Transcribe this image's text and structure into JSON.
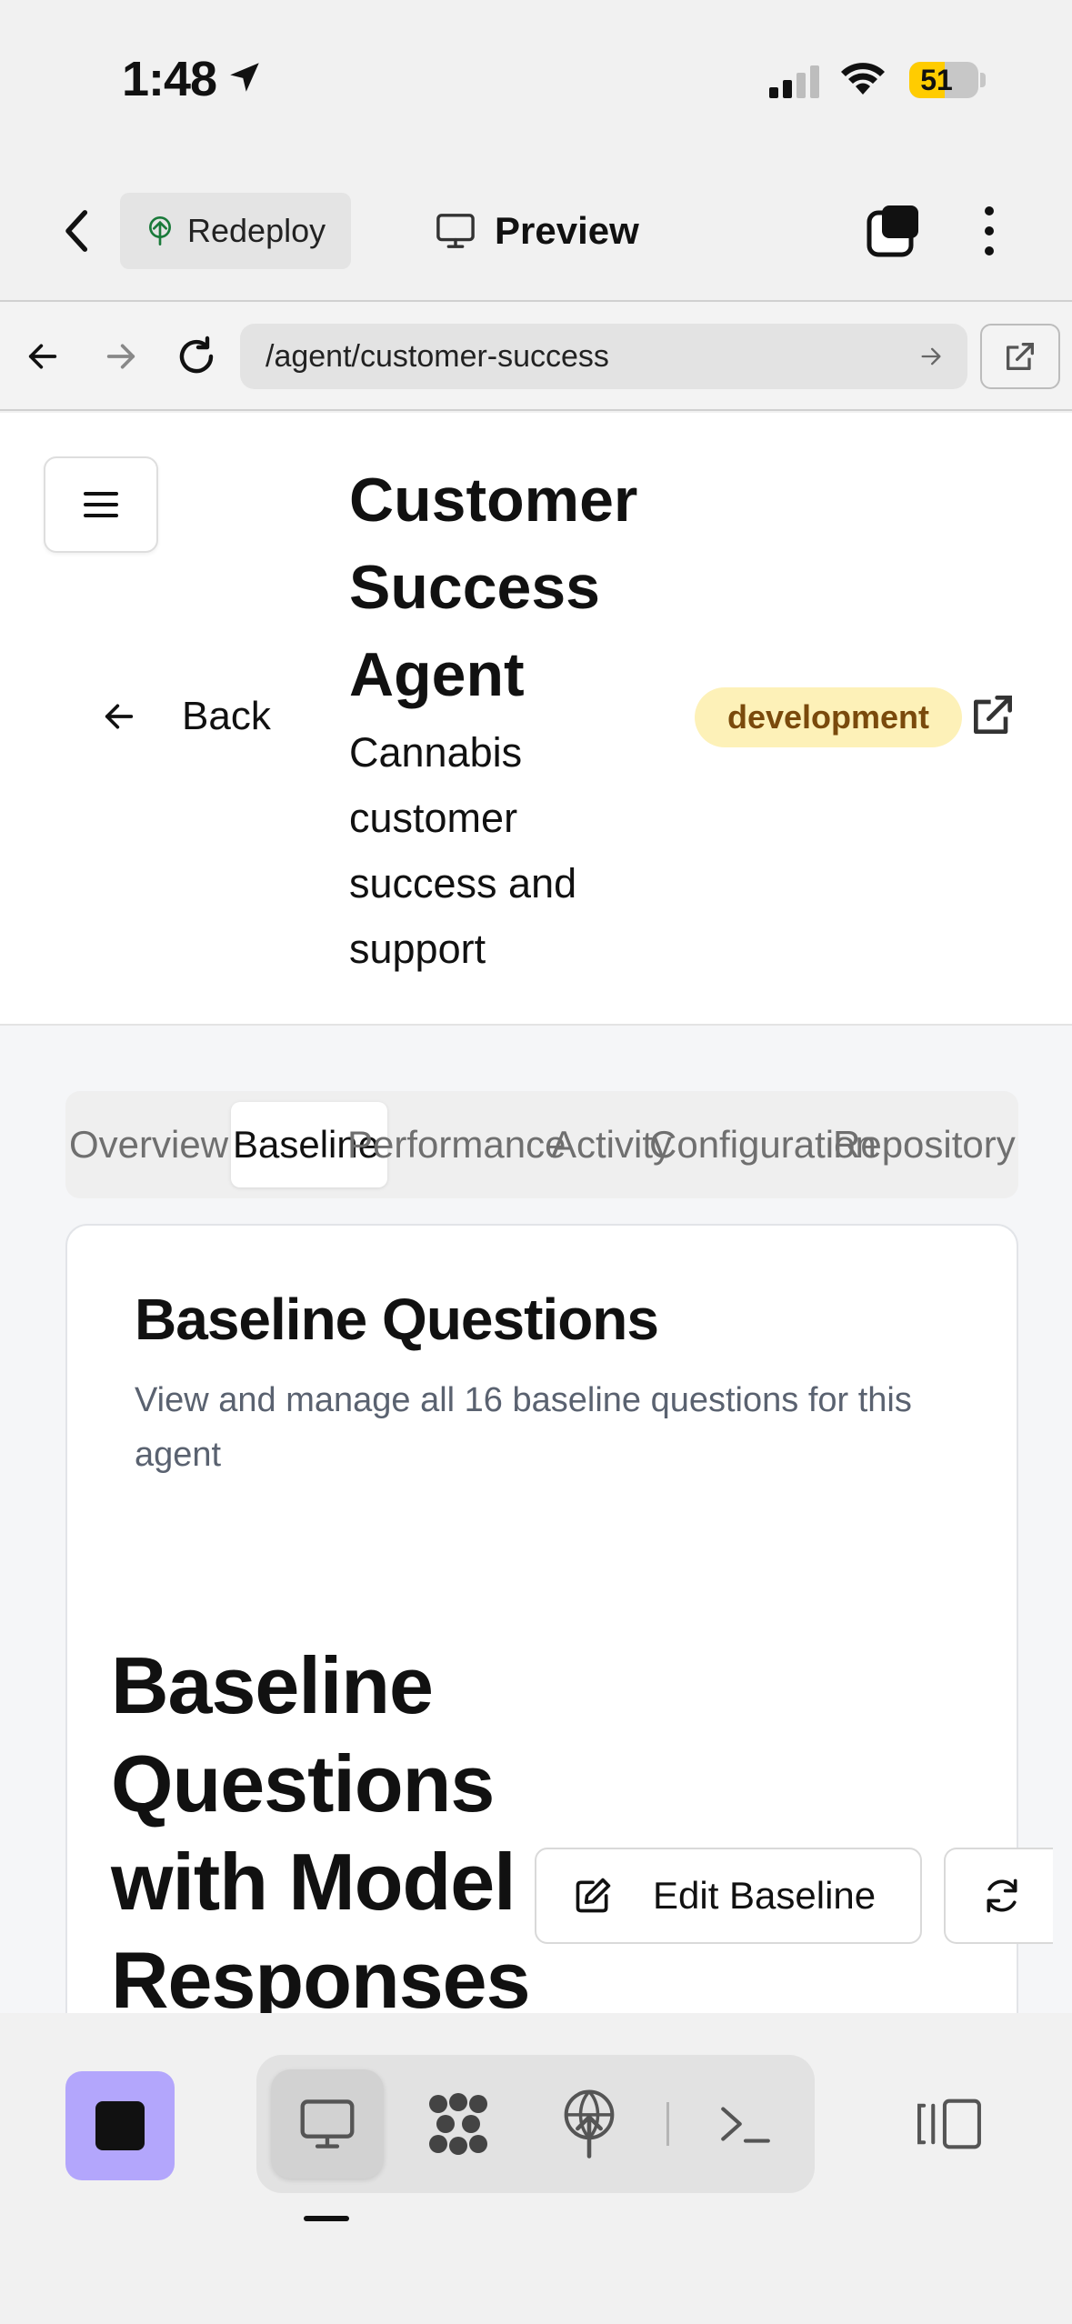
{
  "status_bar": {
    "time": "1:48",
    "battery_level": "51",
    "icons": [
      "location-arrow-icon",
      "cellular-signal-icon",
      "wifi-icon",
      "battery-icon"
    ]
  },
  "app_toolbar": {
    "back_icon": "chevron-left-icon",
    "redeploy_label": "Redeploy",
    "preview_label": "Preview",
    "icons": [
      "redeploy-icon",
      "monitor-icon",
      "stacked-windows-icon",
      "more-vertical-icon"
    ]
  },
  "browser_bar": {
    "url": "/agent/customer-success",
    "icons": [
      "back-arrow-icon",
      "forward-arrow-icon",
      "reload-icon",
      "go-arrow-icon",
      "open-external-icon"
    ]
  },
  "page_header": {
    "back_label": "Back",
    "title": "Customer Success Agent",
    "description": "Cannabis customer success and support",
    "env_badge": "development",
    "colors": {
      "badge_bg": "#fdf1b8",
      "badge_text": "#7a4a0c"
    }
  },
  "tabs": [
    {
      "label": "Overview",
      "active": false
    },
    {
      "label": "Baseline",
      "active": true
    },
    {
      "label": "Performance",
      "active": false
    },
    {
      "label": "Activity",
      "active": false
    },
    {
      "label": "Configuration",
      "active": false
    },
    {
      "label": "Repository",
      "active": false
    }
  ],
  "baseline_card": {
    "title": "Baseline Questions",
    "description": "View and manage all 16 baseline questions for this agent",
    "section_title": "Baseline Questions with Model Responses",
    "edit_button": "Edit Baseline"
  },
  "dock": {
    "accent_color": "#b3a6fc",
    "items": [
      "stop-icon",
      "monitor-icon",
      "dots-grid-icon",
      "deploy-icon",
      "terminal-icon",
      "sidebar-toggle-icon"
    ]
  }
}
